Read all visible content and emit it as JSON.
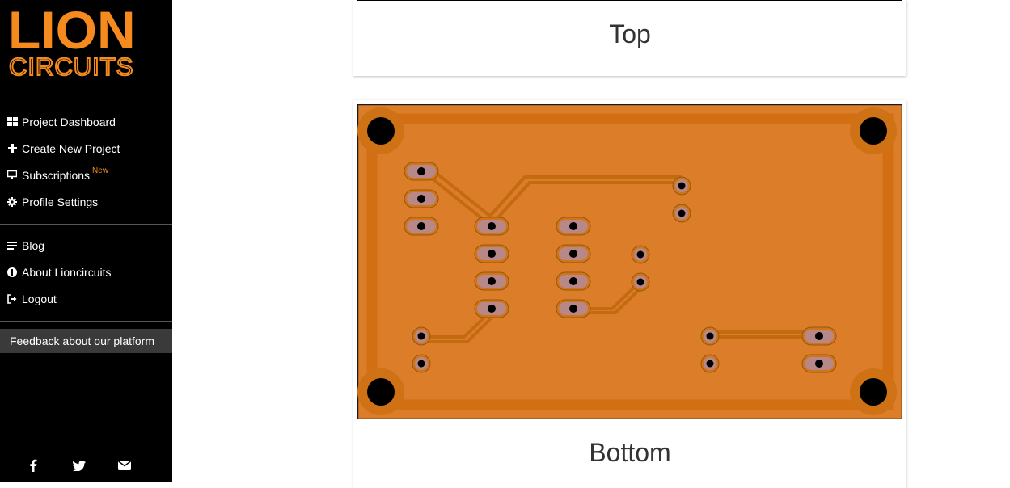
{
  "brand": {
    "logo_line1": "LION",
    "logo_line2": "CIRCUITS",
    "accent_color": "#f58a1f"
  },
  "nav_primary": [
    {
      "label": "Project Dashboard",
      "icon": "dashboard-icon"
    },
    {
      "label": "Create New Project",
      "icon": "plus-icon"
    },
    {
      "label": "Subscriptions",
      "icon": "monitor-icon",
      "badge": "New"
    },
    {
      "label": "Profile Settings",
      "icon": "gear-icon"
    }
  ],
  "nav_secondary": [
    {
      "label": "Blog",
      "icon": "list-icon"
    },
    {
      "label": "About Lioncircuits",
      "icon": "info-icon"
    },
    {
      "label": "Logout",
      "icon": "logout-icon"
    }
  ],
  "feedback_label": "Feedback about our platform",
  "social": [
    "facebook-icon",
    "twitter-icon",
    "envelope-icon"
  ],
  "views": {
    "top_label": "Top",
    "bottom_label": "Bottom"
  },
  "pcb_colors": {
    "board": "#dc7e29",
    "copper": "#c96f12",
    "pad": "#b88787",
    "hole": "#000000"
  }
}
